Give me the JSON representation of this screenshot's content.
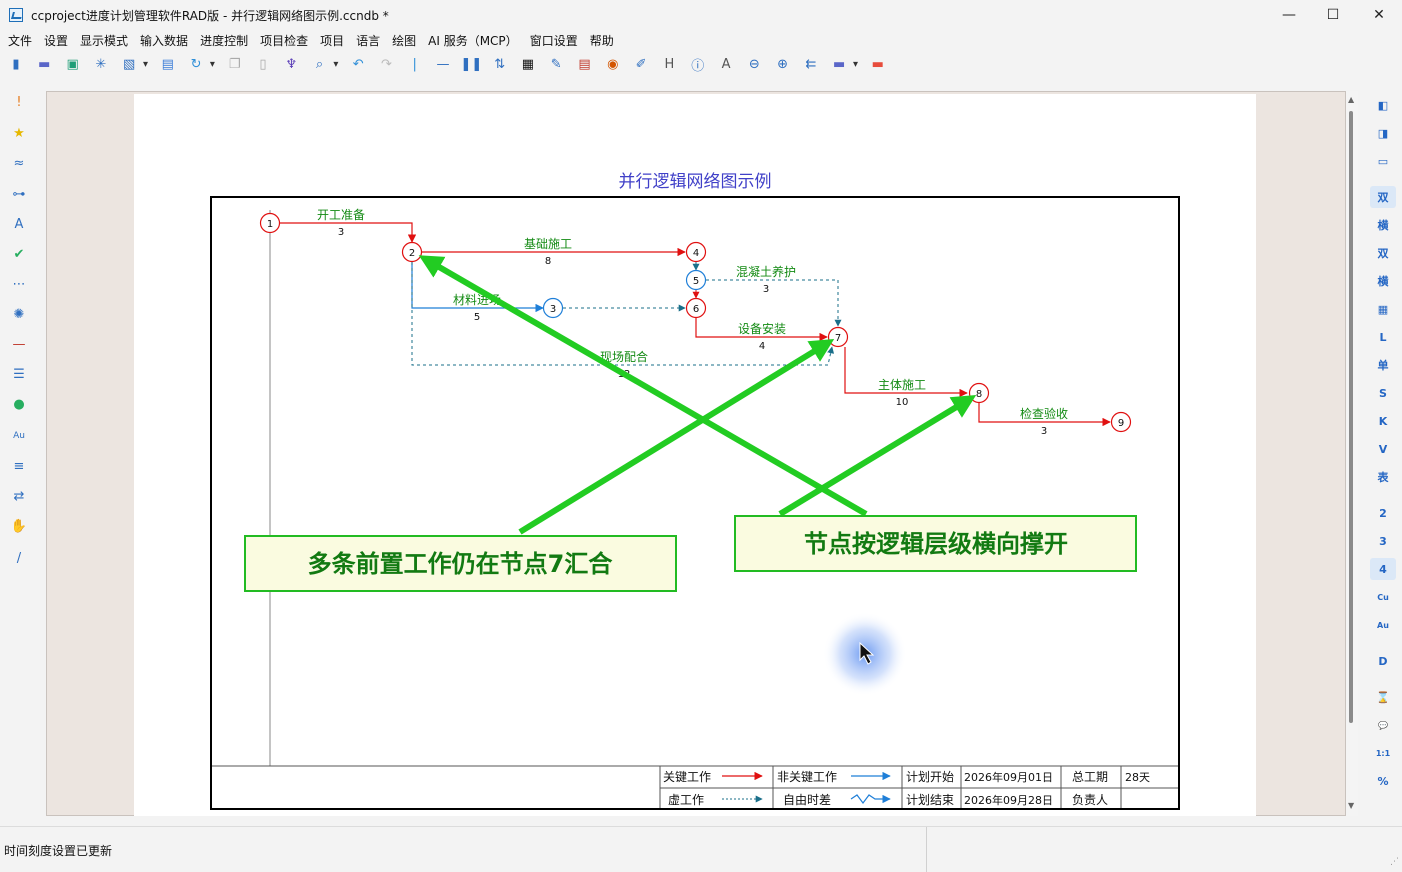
{
  "window": {
    "title": "ccproject进度计划管理软件RAD版 - 并行逻辑网络图示例.ccndb *",
    "controls": {
      "minimize": "—",
      "maximize": "☐",
      "close": "✕"
    }
  },
  "menu": [
    "文件",
    "设置",
    "显示模式",
    "输入数据",
    "进度控制",
    "项目检查",
    "项目",
    "语言",
    "绘图",
    "AI 服务（MCP）",
    "窗口设置",
    "帮助"
  ],
  "toolbar_icons": [
    {
      "icon": "new-db-icon",
      "glyph": "▮",
      "color": "#2f6fc0"
    },
    {
      "icon": "open-folder-icon",
      "glyph": "▬",
      "color": "#5a66c8"
    },
    {
      "icon": "save-icon",
      "glyph": "▣",
      "color": "#1f9e77"
    },
    {
      "icon": "snowflake-icon",
      "glyph": "✳",
      "color": "#2f6fc0"
    },
    {
      "icon": "export-image-icon",
      "glyph": "▧",
      "color": "#2f6fc0"
    },
    {
      "icon": "dropdown-arrow-icon",
      "glyph": "▾",
      "color": "#333"
    },
    {
      "icon": "print-icon",
      "glyph": "▤",
      "color": "#3b7dd8"
    },
    {
      "icon": "refresh-icon",
      "glyph": "↻",
      "color": "#2f8fd8"
    },
    {
      "icon": "dropdown-arrow-icon",
      "glyph": "▾",
      "color": "#333"
    },
    {
      "icon": "copy-icon",
      "glyph": "❐",
      "color": "#aaa"
    },
    {
      "icon": "paste-icon",
      "glyph": "▯",
      "color": "#aaa"
    },
    {
      "icon": "format-brush-icon",
      "glyph": "♆",
      "color": "#5c3fb8"
    },
    {
      "icon": "search-icon",
      "glyph": "⌕",
      "color": "#2f6fc0"
    },
    {
      "icon": "dropdown-arrow-icon",
      "glyph": "▾",
      "color": "#333"
    },
    {
      "icon": "undo-icon",
      "glyph": "↶",
      "color": "#2f8fd8"
    },
    {
      "icon": "redo-icon",
      "glyph": "↷",
      "color": "#bbb"
    },
    {
      "icon": "separator-icon",
      "glyph": "|",
      "color": "#2f8fd8"
    },
    {
      "icon": "line-icon",
      "glyph": "—",
      "color": "#2f6fc0"
    },
    {
      "icon": "columns-icon",
      "glyph": "❚❚",
      "color": "#2f6fc0"
    },
    {
      "icon": "sort-icon",
      "glyph": "⇅",
      "color": "#2f6fc0"
    },
    {
      "icon": "grid-icon",
      "glyph": "▦",
      "color": "#111"
    },
    {
      "icon": "brush-icon",
      "glyph": "✎",
      "color": "#2f6fc0"
    },
    {
      "icon": "report-icon",
      "glyph": "▤",
      "color": "#c0392b"
    },
    {
      "icon": "palette-icon",
      "glyph": "◉",
      "color": "#d35400"
    },
    {
      "icon": "edit-doc-icon",
      "glyph": "✐",
      "color": "#2f6fc0"
    },
    {
      "icon": "heading-icon",
      "glyph": "H",
      "color": "#555"
    },
    {
      "icon": "info-icon",
      "glyph": "ⓘ",
      "color": "#2f6fc0"
    },
    {
      "icon": "text-icon",
      "glyph": "A",
      "color": "#555"
    },
    {
      "icon": "zoom-out-icon",
      "glyph": "⊖",
      "color": "#2f6fc0"
    },
    {
      "icon": "zoom-in-icon",
      "glyph": "⊕",
      "color": "#2f6fc0"
    },
    {
      "icon": "arrows-icon",
      "glyph": "⇇",
      "color": "#2f6fc0"
    },
    {
      "icon": "folder-icon",
      "glyph": "▬",
      "color": "#5a66c8"
    },
    {
      "icon": "dropdown-arrow-icon",
      "glyph": "▾",
      "color": "#333"
    },
    {
      "icon": "red-folder-icon",
      "glyph": "▬",
      "color": "#e74c3c"
    }
  ],
  "left_tools": [
    {
      "icon": "exclamation-icon",
      "glyph": "!",
      "color": "#e67e22"
    },
    {
      "icon": "star-icon",
      "glyph": "★",
      "color": "#e6b800"
    },
    {
      "icon": "wave-icon",
      "glyph": "≈",
      "color": "#2f6fc0"
    },
    {
      "icon": "link-icon",
      "glyph": "⊶",
      "color": "#2f6fc0"
    },
    {
      "icon": "font-icon",
      "glyph": "A",
      "color": "#2f6fc0"
    },
    {
      "icon": "check-icon",
      "glyph": "✔",
      "color": "#27ae60"
    },
    {
      "icon": "dots-line-icon",
      "glyph": "⋯",
      "color": "#2f6fc0"
    },
    {
      "icon": "settings-icon",
      "glyph": "✺",
      "color": "#2f6fc0"
    },
    {
      "icon": "minus-icon",
      "glyph": "—",
      "color": "#c0392b"
    },
    {
      "icon": "sort-list-icon",
      "glyph": "☰",
      "color": "#2f6fc0"
    },
    {
      "icon": "users-icon",
      "glyph": "●",
      "color": "#27ae60"
    },
    {
      "icon": "au-icon",
      "glyph": "Au",
      "color": "#2f6fc0"
    },
    {
      "icon": "filter-icon",
      "glyph": "≡",
      "color": "#2f6fc0"
    },
    {
      "icon": "swap-icon",
      "glyph": "⇄",
      "color": "#2f6fc0"
    },
    {
      "icon": "hand-icon",
      "glyph": "✋",
      "color": "#333"
    },
    {
      "icon": "pen-icon",
      "glyph": "/",
      "color": "#2f6fc0"
    }
  ],
  "right_tools": [
    {
      "label": "◧",
      "active": false
    },
    {
      "label": "◨",
      "active": false
    },
    {
      "label": "▭",
      "active": false
    },
    {
      "label": "双",
      "active": true
    },
    {
      "label": "横",
      "active": false
    },
    {
      "label": "双",
      "active": false
    },
    {
      "label": "横",
      "active": false
    },
    {
      "label": "▦",
      "active": false
    },
    {
      "label": "L",
      "active": false
    },
    {
      "label": "单",
      "active": false
    },
    {
      "label": "S",
      "active": false
    },
    {
      "label": "K",
      "active": false
    },
    {
      "label": "V",
      "active": false
    },
    {
      "label": "表",
      "active": false
    },
    {
      "label": "2",
      "active": false
    },
    {
      "label": "3",
      "active": false
    },
    {
      "label": "4",
      "active": true
    },
    {
      "label": "Cu",
      "active": false
    },
    {
      "label": "Au",
      "active": false
    },
    {
      "label": "D",
      "active": false
    },
    {
      "label": "⌛",
      "active": false
    },
    {
      "label": "💬",
      "active": false
    },
    {
      "label": "1:1",
      "active": false
    },
    {
      "label": "%",
      "active": false
    }
  ],
  "diagram": {
    "title": "并行逻辑网络图示例",
    "nodes": [
      "1",
      "2",
      "3",
      "4",
      "5",
      "6",
      "7",
      "8",
      "9"
    ],
    "activities": [
      {
        "name": "开工准备",
        "duration": "3",
        "type": "critical"
      },
      {
        "name": "基础施工",
        "duration": "8",
        "type": "critical"
      },
      {
        "name": "材料进场",
        "duration": "5",
        "type": "noncritical"
      },
      {
        "name": "混凝土养护",
        "duration": "3",
        "type": "dummy"
      },
      {
        "name": "设备安装",
        "duration": "4",
        "type": "critical"
      },
      {
        "name": "现场配合",
        "duration": "12",
        "type": "dummy"
      },
      {
        "name": "主体施工",
        "duration": "10",
        "type": "critical"
      },
      {
        "name": "检查验收",
        "duration": "3",
        "type": "critical"
      }
    ],
    "legend": {
      "critical": "关键工作",
      "noncritical": "非关键工作",
      "dummy": "虚工作",
      "float": "自由时差",
      "plan_start_label": "计划开始",
      "plan_start": "2026年09月01日",
      "plan_end_label": "计划结束",
      "plan_end": "2026年09月28日",
      "total_label": "总工期",
      "total": "28天",
      "owner_label": "负责人",
      "owner": ""
    },
    "callouts": {
      "left": "多条前置工作仍在节点7汇合",
      "right": "节点按逻辑层级横向撑开"
    },
    "colors": {
      "critical": "#e01010",
      "noncritical": "#1f7fd8",
      "dummy": "#1a6f8a",
      "label": "#138a13",
      "title": "#4040c8",
      "callout_arrow": "#22cc22",
      "callout_text": "#127a12",
      "callout_bg": "#fafbe0"
    }
  },
  "status": {
    "message": "时间刻度设置已更新"
  }
}
